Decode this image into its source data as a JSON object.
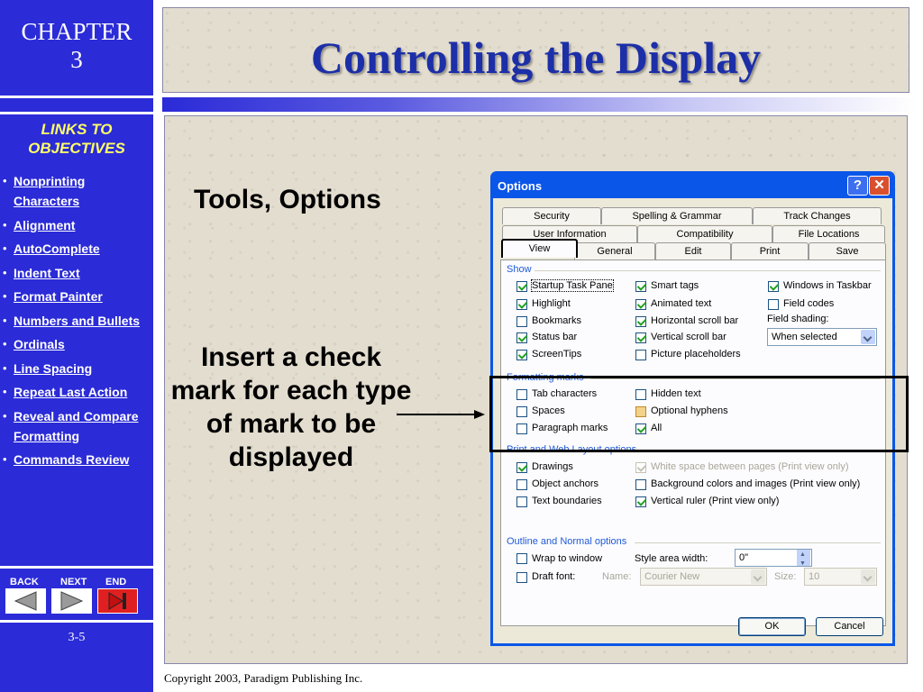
{
  "sidebar": {
    "chapter_word": "CHAPTER",
    "chapter_number": "3",
    "links_heading_line1": "LINKS TO",
    "links_heading_line2": "OBJECTIVES",
    "links": [
      "Nonprinting Characters",
      "Alignment",
      "AutoComplete",
      "Indent Text",
      "Format Painter",
      "Numbers and Bullets",
      "Ordinals",
      "Line Spacing",
      "Repeat Last Action",
      "Reveal and Compare Formatting",
      "Commands Review"
    ],
    "nav": {
      "back": "BACK",
      "next": "NEXT",
      "end": "END"
    },
    "page_number": "3-5"
  },
  "slide": {
    "title": "Controlling the Display",
    "heading1": "Tools, Options",
    "heading2": "Insert a check mark for each type of mark to be displayed",
    "copyright": "Copyright 2003, Paradigm Publishing Inc."
  },
  "dialog": {
    "title": "Options",
    "tabs_row1": [
      "Security",
      "Spelling & Grammar",
      "Track Changes"
    ],
    "tabs_row2": [
      "User Information",
      "Compatibility",
      "File Locations"
    ],
    "tabs_row3": [
      "View",
      "General",
      "Edit",
      "Print",
      "Save"
    ],
    "active_tab": "View",
    "show": {
      "label": "Show",
      "startup_task_pane": {
        "label": "Startup Task Pane",
        "checked": true
      },
      "highlight": {
        "label": "Highlight",
        "checked": true
      },
      "bookmarks": {
        "label": "Bookmarks",
        "checked": false
      },
      "status_bar": {
        "label": "Status bar",
        "checked": true
      },
      "screentips": {
        "label": "ScreenTips",
        "checked": true
      },
      "smart_tags": {
        "label": "Smart tags",
        "checked": true
      },
      "animated_text": {
        "label": "Animated text",
        "checked": true
      },
      "horizontal_scroll_bar": {
        "label": "Horizontal scroll bar",
        "checked": true
      },
      "vertical_scroll_bar": {
        "label": "Vertical scroll bar",
        "checked": true
      },
      "picture_placeholders": {
        "label": "Picture placeholders",
        "checked": false
      },
      "windows_in_taskbar": {
        "label": "Windows in Taskbar",
        "checked": true
      },
      "field_codes": {
        "label": "Field codes",
        "checked": false
      },
      "field_shading_label": "Field shading:",
      "field_shading_value": "When selected"
    },
    "formatting_marks": {
      "label": "Formatting marks",
      "tab_characters": {
        "label": "Tab characters",
        "checked": false
      },
      "spaces": {
        "label": "Spaces",
        "checked": false
      },
      "paragraph_marks": {
        "label": "Paragraph marks",
        "checked": false
      },
      "hidden_text": {
        "label": "Hidden text",
        "checked": false
      },
      "optional_hyphens": {
        "label": "Optional hyphens",
        "checked": false
      },
      "all": {
        "label": "All",
        "checked": true
      }
    },
    "print_web": {
      "label": "Print and Web Layout options",
      "drawings": {
        "label": "Drawings",
        "checked": true
      },
      "object_anchors": {
        "label": "Object anchors",
        "checked": false
      },
      "text_boundaries": {
        "label": "Text boundaries",
        "checked": false
      },
      "white_space": {
        "label": "White space between pages (Print view only)",
        "checked": true
      },
      "background_colors": {
        "label": "Background colors and images (Print view only)",
        "checked": false
      },
      "vertical_ruler": {
        "label": "Vertical ruler (Print view only)",
        "checked": true
      }
    },
    "outline_normal": {
      "label": "Outline and Normal options",
      "wrap_to_window": {
        "label": "Wrap to window",
        "checked": false
      },
      "draft_font": {
        "label": "Draft font:",
        "checked": false
      },
      "style_area_label": "Style area width:",
      "style_area_value": "0\"",
      "name_label": "Name:",
      "name_value": "Courier New",
      "size_label": "Size:",
      "size_value": "10"
    },
    "ok": "OK",
    "cancel": "Cancel"
  }
}
